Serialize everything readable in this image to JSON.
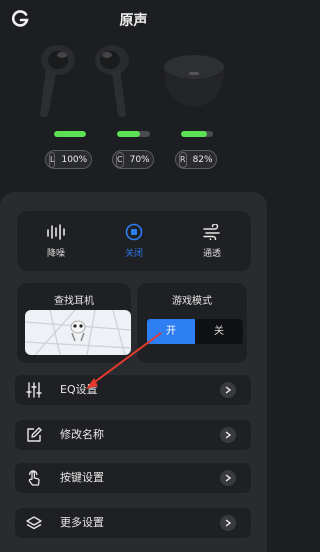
{
  "header": {
    "title": "原声"
  },
  "buds": [
    {
      "label": "L",
      "value": "100%",
      "level": 1.0
    },
    {
      "label": "C",
      "value": "70%",
      "level": 0.7
    },
    {
      "label": "R",
      "value": "82%",
      "level": 0.82
    }
  ],
  "modes": [
    {
      "label": "降噪",
      "icon": "noise-cancel-icon"
    },
    {
      "label": "关闭",
      "icon": "stop-icon",
      "selected": true
    },
    {
      "label": "通透",
      "icon": "wind-icon"
    }
  ],
  "find_earbuds": {
    "title": "查找耳机"
  },
  "game_mode": {
    "title": "游戏模式",
    "on": "开",
    "off": "关",
    "state": "on"
  },
  "rows": [
    {
      "label": "EQ设置",
      "icon": "equalizer-icon"
    },
    {
      "label": "修改名称",
      "icon": "edit-icon"
    },
    {
      "label": "按键设置",
      "icon": "touch-icon"
    },
    {
      "label": "更多设置",
      "icon": "layers-icon"
    }
  ],
  "colors": {
    "accent": "#2c7ef2",
    "battery": "#5be153",
    "annotation_arrow": "#e23b2e"
  }
}
